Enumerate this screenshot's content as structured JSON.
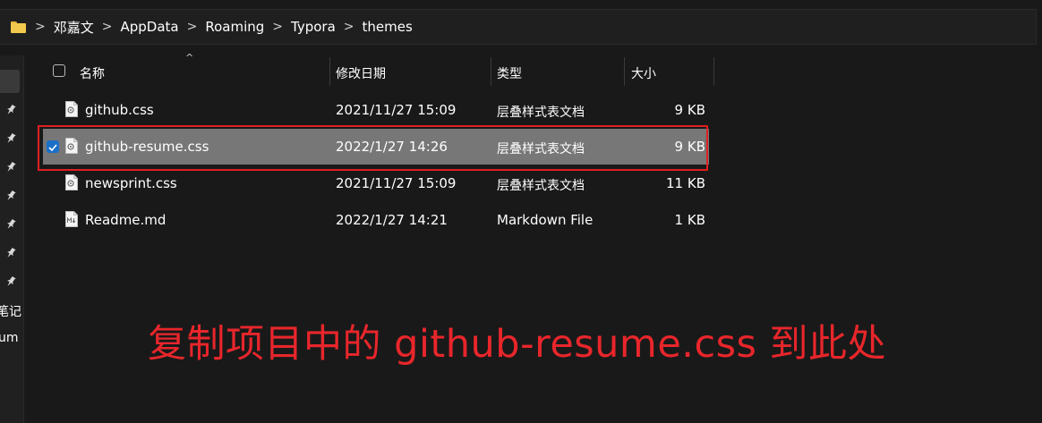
{
  "breadcrumb": {
    "items": [
      "邓嘉文",
      "AppData",
      "Roaming",
      "Typora",
      "themes"
    ],
    "separator": ">"
  },
  "sidebar": {
    "partial_labels": [
      "笔记",
      "um"
    ]
  },
  "columns": {
    "name": "名称",
    "modified": "修改日期",
    "type": "类型",
    "size": "大小"
  },
  "files": [
    {
      "name": "github.css",
      "modified": "2021/11/27 15:09",
      "type": "层叠样式表文档",
      "size": "9 KB",
      "selected": false,
      "icon": "css-file-icon"
    },
    {
      "name": "github-resume.css",
      "modified": "2022/1/27 14:26",
      "type": "层叠样式表文档",
      "size": "9 KB",
      "selected": true,
      "icon": "css-file-icon"
    },
    {
      "name": "newsprint.css",
      "modified": "2021/11/27 15:09",
      "type": "层叠样式表文档",
      "size": "11 KB",
      "selected": false,
      "icon": "css-file-icon"
    },
    {
      "name": "Readme.md",
      "modified": "2022/1/27 14:21",
      "type": "Markdown File",
      "size": "1 KB",
      "selected": false,
      "icon": "markdown-file-icon"
    }
  ],
  "annotation": {
    "text": "复制项目中的 github-resume.css 到此处",
    "color": "#e8262b"
  },
  "colors": {
    "background": "#191919",
    "selected_row": "#777777",
    "highlight_box": "#e02020",
    "checkbox_accent": "#1a6fc9",
    "folder": "#f2c94c"
  }
}
